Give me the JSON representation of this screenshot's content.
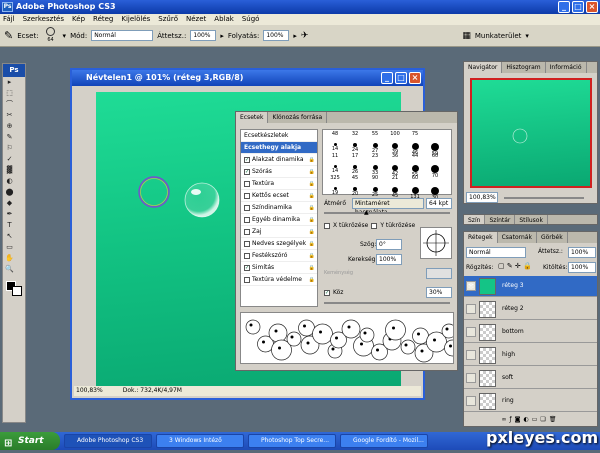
{
  "app": {
    "title": "Adobe Photoshop CS3",
    "logo": "Ps"
  },
  "menu": [
    "Fájl",
    "Szerkesztés",
    "Kép",
    "Réteg",
    "Kijelölés",
    "Szűrő",
    "Nézet",
    "Ablak",
    "Súgó"
  ],
  "options": {
    "brush_label": "Ecset:",
    "brush_size": "64",
    "mode_label": "Mód:",
    "mode_value": "Normál",
    "opacity_label": "Áttetsz.:",
    "opacity_value": "100%",
    "flow_label": "Folyatás:",
    "flow_value": "100%",
    "workspace": "Munkaterület"
  },
  "document": {
    "title": "Névtelen1 @ 101% (réteg 3,RGB/8)",
    "zoom": "100,83%",
    "docinfo": "Dok.: 732,4K/4,97M"
  },
  "brushes": {
    "tabs": [
      "Ecsetek",
      "Klónozás forrása"
    ],
    "list": [
      {
        "label": "Ecsetkészletek",
        "check": false,
        "sel": false,
        "hascb": false
      },
      {
        "label": "Ecsethegy alakja",
        "check": false,
        "sel": true,
        "hascb": false
      },
      {
        "label": "Alakzat dinamika",
        "check": true,
        "sel": false,
        "hascb": true
      },
      {
        "label": "Szórás",
        "check": true,
        "sel": false,
        "hascb": true
      },
      {
        "label": "Textúra",
        "check": false,
        "sel": false,
        "hascb": true
      },
      {
        "label": "Kettős ecset",
        "check": false,
        "sel": false,
        "hascb": true
      },
      {
        "label": "Színdinamika",
        "check": false,
        "sel": false,
        "hascb": true
      },
      {
        "label": "Egyéb dinamika",
        "check": false,
        "sel": false,
        "hascb": true
      },
      {
        "label": "Zaj",
        "check": false,
        "sel": false,
        "hascb": true
      },
      {
        "label": "Nedves szegélyek",
        "check": false,
        "sel": false,
        "hascb": true
      },
      {
        "label": "Festékszóró",
        "check": false,
        "sel": false,
        "hascb": true
      },
      {
        "label": "Simítás",
        "check": true,
        "sel": false,
        "hascb": true
      },
      {
        "label": "Textúra védelme",
        "check": false,
        "sel": false,
        "hascb": true
      }
    ],
    "tips": [
      "48",
      "32",
      "55",
      "100",
      "75",
      "",
      "14",
      "24",
      "27",
      "39",
      "46",
      "59",
      "11",
      "17",
      "23",
      "36",
      "44",
      "60",
      "14",
      "26",
      "33",
      "42",
      "55",
      "70",
      "325",
      "45",
      "90",
      "21",
      "60",
      "",
      "19",
      "20",
      "25",
      "45",
      "131",
      "30"
    ],
    "diameter_label": "Átmérő",
    "master_btn": "Mintaméret használata",
    "diameter_value": "64 kpt",
    "flip_x": "X tükrözése",
    "flip_y": "Y tükrözése",
    "angle_label": "Szög:",
    "angle_value": "0°",
    "roundness_label": "Kerekség:",
    "roundness_value": "100%",
    "hardness_label": "Keménység",
    "spacing_label": "Köz",
    "spacing_value": "30%"
  },
  "navigator": {
    "tabs": [
      "Navigátor",
      "Hisztogram",
      "Információ"
    ],
    "zoom": "100,83%"
  },
  "swatches_tabs": [
    "Szín",
    "Színtár",
    "Stílusok"
  ],
  "layers": {
    "tabs": [
      "Rétegek",
      "Csatornák",
      "Görbék"
    ],
    "mode": "Normál",
    "opacity_label": "Áttetsz.:",
    "opacity_value": "100%",
    "lock_label": "Rögzítés:",
    "fill_label": "Kitöltés:",
    "fill_value": "100%",
    "items": [
      {
        "name": "réteg 3",
        "sel": true,
        "visible": true,
        "green": true
      },
      {
        "name": "réteg 2",
        "sel": false,
        "visible": false,
        "green": false
      },
      {
        "name": "bottom",
        "sel": false,
        "visible": false,
        "green": false
      },
      {
        "name": "high",
        "sel": false,
        "visible": false,
        "green": false
      },
      {
        "name": "soft",
        "sel": false,
        "visible": false,
        "green": false
      },
      {
        "name": "ring",
        "sel": false,
        "visible": false,
        "green": false
      }
    ]
  },
  "taskbar": {
    "start": "Start",
    "items": [
      "Adobe Photoshop CS3",
      "3 Windows Intéző",
      "Photoshop Top Secre...",
      "Google Fordító - Mozil..."
    ]
  },
  "watermark": "pxleyes.com",
  "colors": {
    "canvas": "#14c486",
    "titlebar": "#1043b8",
    "selection": "#316ac5"
  }
}
